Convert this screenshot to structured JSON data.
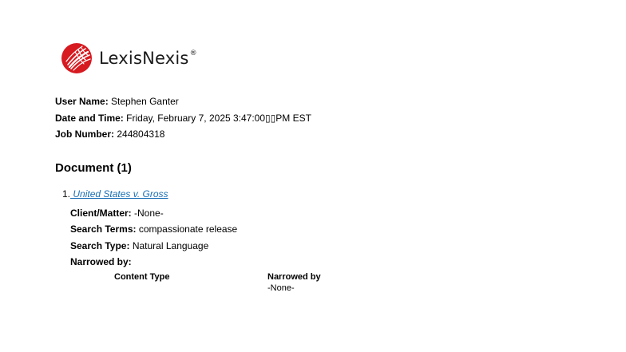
{
  "brand": {
    "name": "LexisNexis",
    "registered_mark": "®",
    "color": "#d71920"
  },
  "meta": {
    "user_name_label": "User Name:",
    "user_name": "Stephen Ganter",
    "date_label": "Date and Time:",
    "date_value": "Friday, February 7, 2025 3:47:00▯▯PM EST",
    "job_label": "Job Number:",
    "job_value": "244804318"
  },
  "document": {
    "heading": "Document (1)",
    "items": [
      {
        "number": "1.",
        "title": " United States v. Gross",
        "link_color": "#1a6fb5",
        "client_matter_label": "Client/Matter:",
        "client_matter": "-None-",
        "search_terms_label": "Search Terms:",
        "search_terms": "compassionate release",
        "search_type_label": "Search Type:",
        "search_type": "Natural Language",
        "narrowed_label": "Narrowed by:",
        "narrowed_table": {
          "headers": [
            "Content Type",
            "Narrowed by"
          ],
          "values": [
            "",
            "-None-"
          ]
        }
      }
    ]
  }
}
